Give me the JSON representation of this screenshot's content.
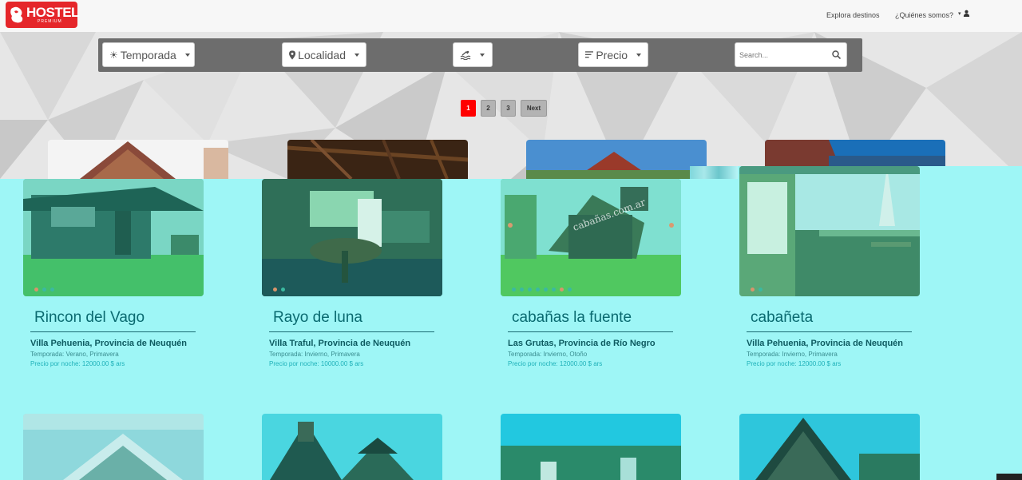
{
  "header": {
    "logo_text": "HOSTEL",
    "logo_sub": "PREMIUM",
    "nav": [
      "Explora destinos",
      "¿Quiénes somos?"
    ]
  },
  "filters": {
    "temporada": "Temporada",
    "localidad": "Localidad",
    "precio": "Precio",
    "search_placeholder": "Search..."
  },
  "pagination": {
    "pages": [
      "1",
      "2",
      "3"
    ],
    "next": "Next"
  },
  "cards": [
    {
      "title": "Rincon del Vago",
      "location": "Villa Pehuenia, Provincia de Neuquén",
      "season": "Temporada: Verano, Primavera",
      "price": "Precio por noche: 12000.00 $ ars"
    },
    {
      "title": "Rayo de luna",
      "location": "Villa Traful, Provincia de Neuquén",
      "season": "Temporada: Invierno, Primavera",
      "price": "Precio por noche: 10000.00 $ ars"
    },
    {
      "title": "cabañas la fuente",
      "location": "Las Grutas, Provincia de Río Negro",
      "season": "Temporada: Invierno, Otoño",
      "price": "Precio por noche: 12000.00 $ ars"
    },
    {
      "title": "cabañeta",
      "location": "Villa Pehuenia, Provincia de Neuquén",
      "season": "Temporada: Invierno, Primavera",
      "price": "Precio por noche: 12000.00 $ ars"
    }
  ],
  "watermark": "cabañas.com.ar",
  "colors": {
    "brand": "#e5262a",
    "page_active": "#ff0000",
    "overlay": "#9ef6f6"
  }
}
